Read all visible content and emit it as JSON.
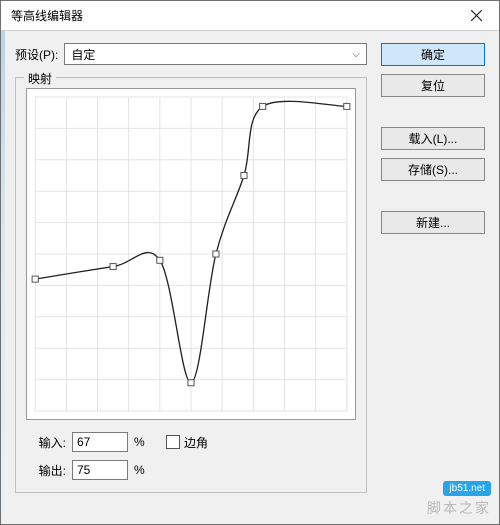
{
  "window": {
    "title": "等高线编辑器"
  },
  "preset": {
    "label": "预设(P):",
    "selected": "自定"
  },
  "mapping": {
    "legend": "映射",
    "input_label": "输入:",
    "output_label": "输出:",
    "input_value": "67",
    "output_value": "75",
    "percent": "%",
    "corner_label": "边角"
  },
  "buttons": {
    "ok": "确定",
    "reset": "复位",
    "load": "载入(L)...",
    "save": "存储(S)...",
    "new": "新建..."
  },
  "chart_data": {
    "type": "line",
    "title": "",
    "xlabel": "输入",
    "ylabel": "输出",
    "xlim": [
      0,
      100
    ],
    "ylim": [
      0,
      100
    ],
    "grid": true,
    "points": [
      {
        "x": 0,
        "y": 42,
        "corner": false
      },
      {
        "x": 25,
        "y": 46,
        "corner": false
      },
      {
        "x": 40,
        "y": 48,
        "corner": false
      },
      {
        "x": 50,
        "y": 9,
        "corner": false
      },
      {
        "x": 58,
        "y": 50,
        "corner": false
      },
      {
        "x": 67,
        "y": 75,
        "corner": false
      },
      {
        "x": 73,
        "y": 97,
        "corner": false
      },
      {
        "x": 100,
        "y": 97,
        "corner": false
      }
    ]
  },
  "watermark": {
    "badge": "jb51.net",
    "text": "脚本之家"
  }
}
